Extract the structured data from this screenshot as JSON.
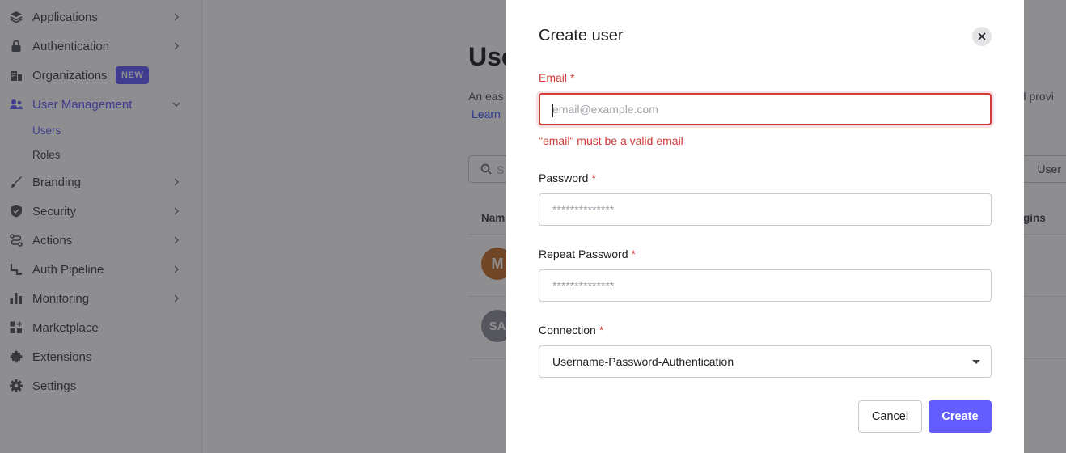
{
  "sidebar": {
    "items": [
      {
        "label": "Applications",
        "icon": "layers-icon"
      },
      {
        "label": "Authentication",
        "icon": "lock-icon"
      },
      {
        "label": "Organizations",
        "icon": "building-icon",
        "badge": "NEW"
      },
      {
        "label": "User Management",
        "icon": "users-icon"
      },
      {
        "label": "Branding",
        "icon": "brush-icon"
      },
      {
        "label": "Security",
        "icon": "shield-icon"
      },
      {
        "label": "Actions",
        "icon": "flow-icon"
      },
      {
        "label": "Auth Pipeline",
        "icon": "pipeline-icon"
      },
      {
        "label": "Monitoring",
        "icon": "bar-chart-icon"
      },
      {
        "label": "Marketplace",
        "icon": "grid-plus-icon"
      },
      {
        "label": "Extensions",
        "icon": "puzzle-icon"
      },
      {
        "label": "Settings",
        "icon": "gear-icon"
      }
    ],
    "sub_items": [
      {
        "label": "Users"
      },
      {
        "label": "Roles"
      }
    ]
  },
  "main": {
    "title": "Use",
    "description": "An eas",
    "description_right": "nd provi",
    "learn_link": "Learn",
    "search_placeholder": "S",
    "create_user_button": "User",
    "columns": {
      "name": "Nam",
      "logins": "gins"
    },
    "rows": [
      {
        "initials": "M",
        "avatar_color": "#c56f2a"
      },
      {
        "initials": "SA",
        "avatar_color": "#8c8f96"
      }
    ]
  },
  "modal": {
    "title": "Create user",
    "email": {
      "label": "Email",
      "required": "*",
      "placeholder": "email@example.com",
      "error": "\"email\" must be a valid email"
    },
    "password": {
      "label": "Password",
      "required": "*",
      "placeholder": "**************"
    },
    "repeat_password": {
      "label": "Repeat Password",
      "required": "*",
      "placeholder": "**************"
    },
    "connection": {
      "label": "Connection",
      "required": "*",
      "value": "Username-Password-Authentication"
    },
    "cancel_label": "Cancel",
    "create_label": "Create"
  },
  "colors": {
    "accent": "#635dff",
    "error": "#d03c38"
  }
}
